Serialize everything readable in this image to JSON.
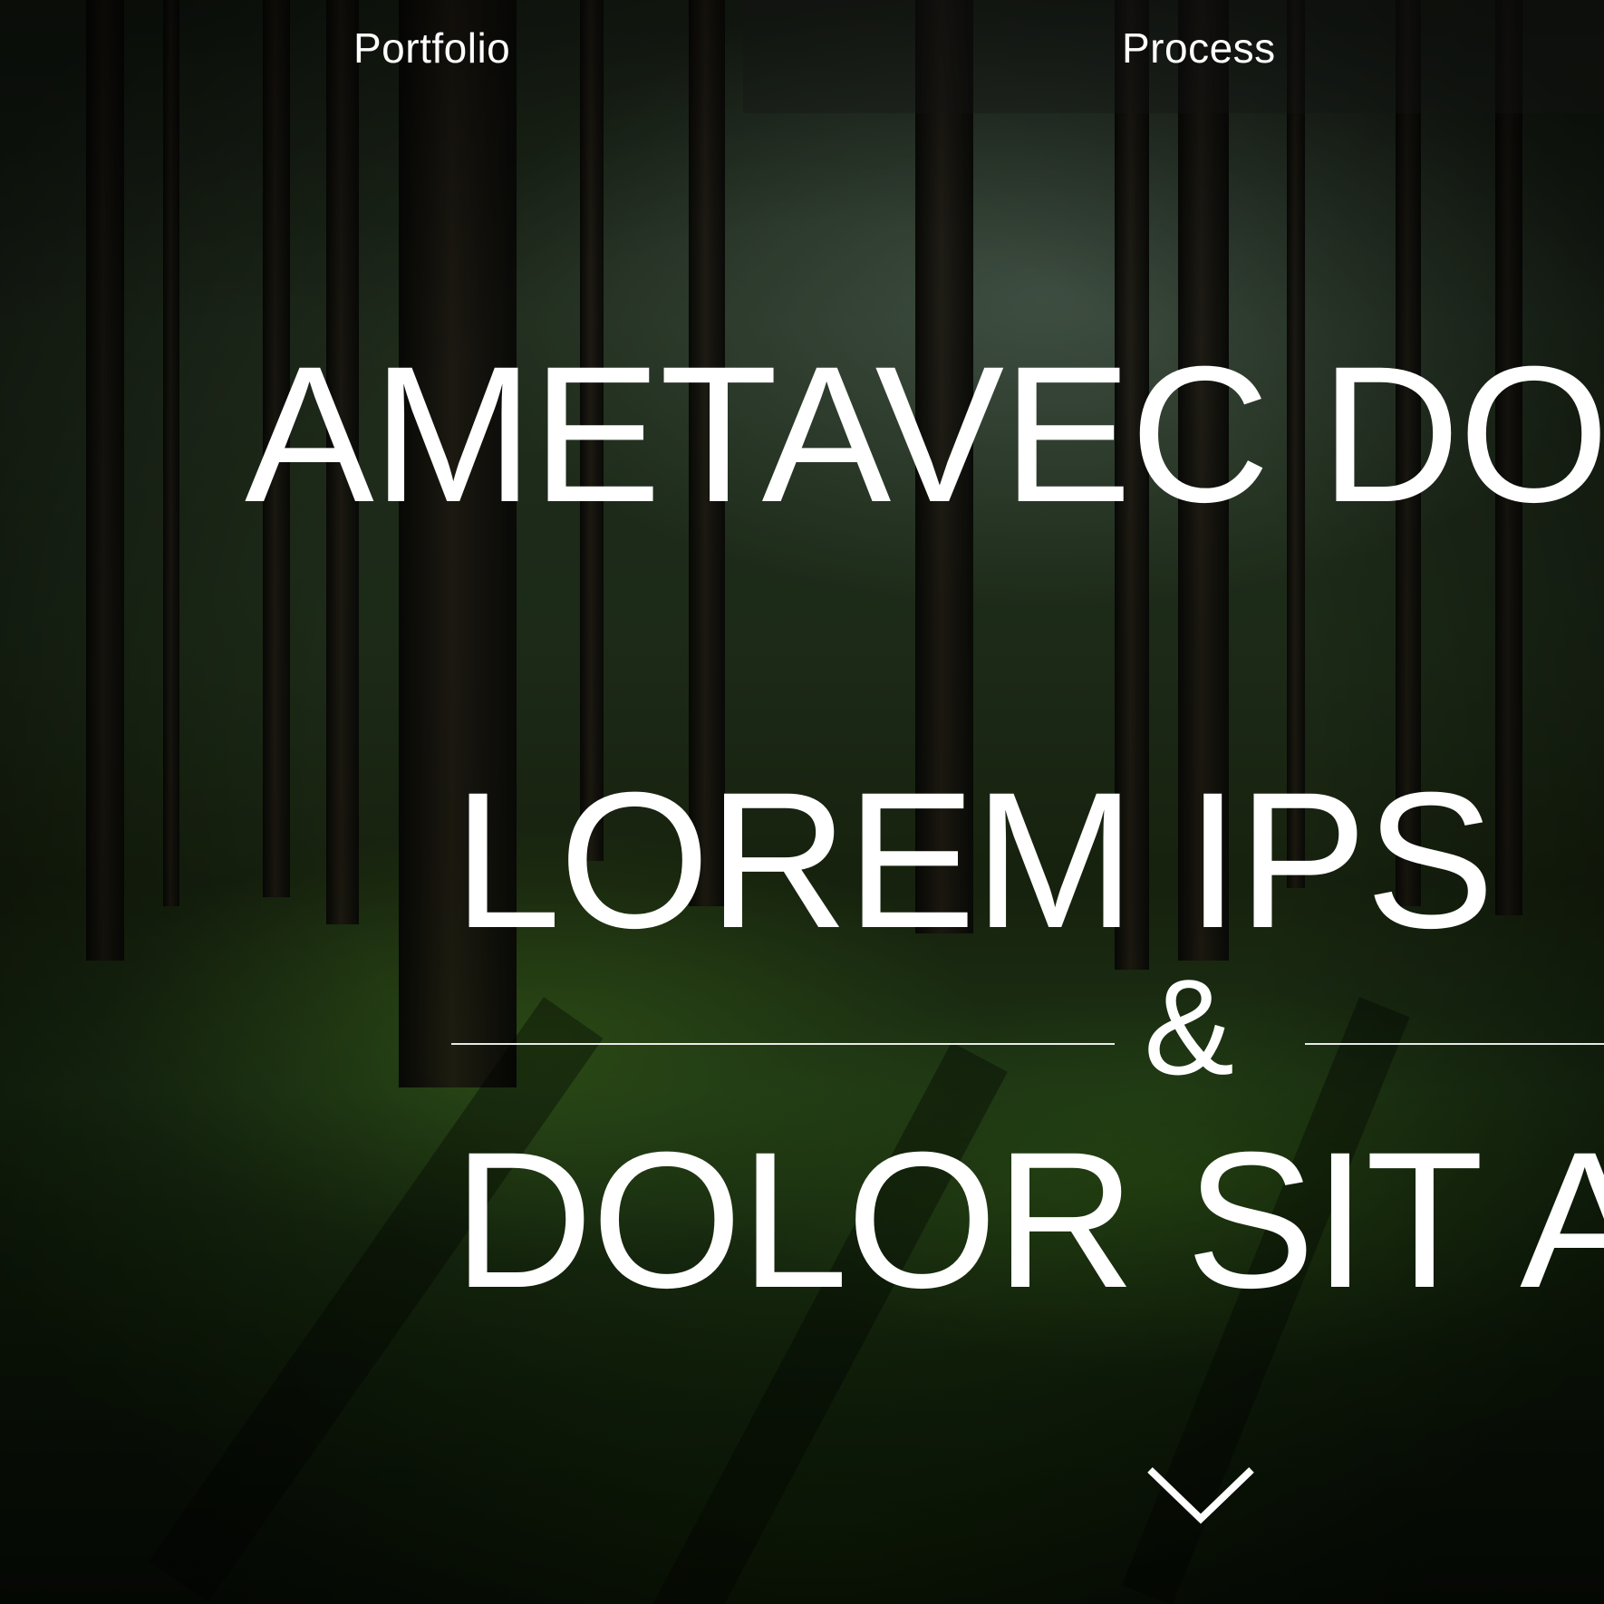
{
  "nav": {
    "portfolio_label": "Portfolio",
    "process_label": "Process"
  },
  "hero": {
    "line1": "AMETAVEC DO",
    "line2": "LOREM IPS",
    "ampersand": "&",
    "line4": "DOLOR SIT AI"
  },
  "scroll": {
    "icon": "chevron-down-icon"
  }
}
